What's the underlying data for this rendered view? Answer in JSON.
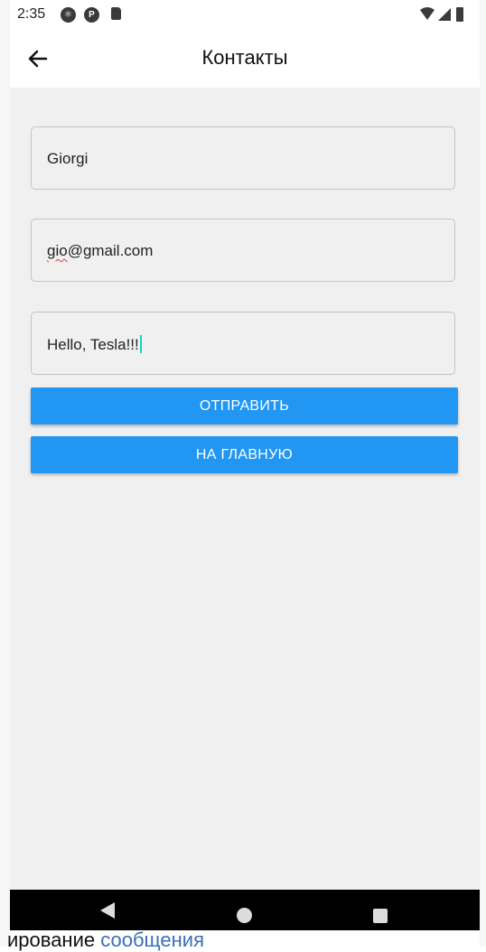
{
  "status_bar": {
    "time": "2:35",
    "icons": [
      "react-native-icon",
      "pinterest-style-icon",
      "sd-card-icon",
      "wifi-icon",
      "signal-icon",
      "battery-icon"
    ]
  },
  "app_bar": {
    "title": "Контакты",
    "back_icon": "arrow-left-icon"
  },
  "form": {
    "name_value": "Giorgi",
    "email_misspelled": "gio",
    "email_rest": "@gmail.com",
    "message_value": "Hello, Tesla!!!"
  },
  "buttons": {
    "send_label": "ОТПРАВИТЬ",
    "home_label": "НА ГЛАВНУЮ"
  },
  "nav_bar": {
    "icons": [
      "nav-back-icon",
      "nav-home-icon",
      "nav-recents-icon"
    ]
  },
  "background_page": {
    "text_dark": "ирование ",
    "text_blue": "сообщения"
  },
  "colors": {
    "primary": "#2196f3",
    "screen_bg": "#f0f0f0",
    "cursor": "#19d3c5"
  }
}
